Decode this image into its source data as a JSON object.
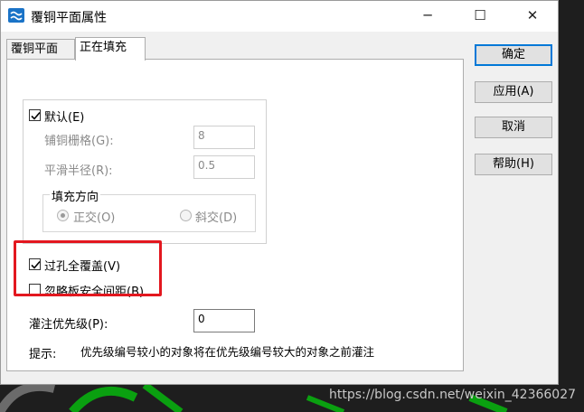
{
  "window": {
    "title": "覆铜平面属性"
  },
  "tabs": [
    {
      "label": "覆铜平面"
    },
    {
      "label": "正在填充"
    }
  ],
  "fill": {
    "default_checkbox": {
      "label": "默认(E)",
      "checked": true
    },
    "grid_label": "铺铜栅格(G):",
    "grid_value": "8",
    "smooth_label": "平滑半径(R):",
    "smooth_value": "0.5",
    "direction_group": {
      "title": "填充方向",
      "options": [
        {
          "label": "正交(O)",
          "selected": true
        },
        {
          "label": "斜交(D)",
          "selected": false
        }
      ]
    },
    "via_cover": {
      "label": "过孔全覆盖(V)",
      "checked": true
    },
    "ignore_clearance": {
      "label": "忽略板安全间距(B)",
      "checked": false
    },
    "priority_label": "灌注优先级(P):",
    "priority_value": "0",
    "hint_label": "提示:",
    "hint_text": "优先级编号较小的对象将在优先级编号较大的对象之前灌注"
  },
  "buttons": {
    "ok": "确定",
    "apply": "应用(A)",
    "cancel": "取消",
    "help": "帮助(H)"
  },
  "watermark": "https://blog.csdn.net/weixin_42366027"
}
